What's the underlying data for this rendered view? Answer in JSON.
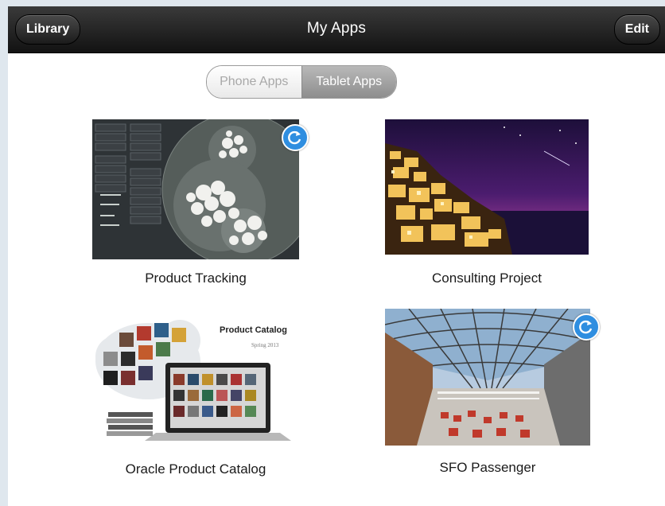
{
  "navbar": {
    "title": "My Apps",
    "left_button": "Library",
    "right_button": "Edit"
  },
  "segmented": {
    "options": [
      "Phone Apps",
      "Tablet Apps"
    ],
    "selected": "Tablet Apps"
  },
  "apps": [
    {
      "name": "Product Tracking",
      "sync_badge": true,
      "thumb_icon": "bubble-chart-dashboard"
    },
    {
      "name": "Consulting Project",
      "sync_badge": false,
      "thumb_icon": "night-village-photo"
    },
    {
      "name": "Oracle Product Catalog",
      "sync_badge": false,
      "thumb_icon": "product-catalog-devices",
      "thumb_text": {
        "title": "Product Catalog",
        "subtitle": "Spring 2013"
      }
    },
    {
      "name": "SFO Passenger",
      "sync_badge": true,
      "thumb_icon": "airport-terminal-photo"
    }
  ],
  "colors": {
    "navbar": "#1e1e1e",
    "accent_badge": "#2f8ee0",
    "segment_selected": "#9e9e9e"
  }
}
